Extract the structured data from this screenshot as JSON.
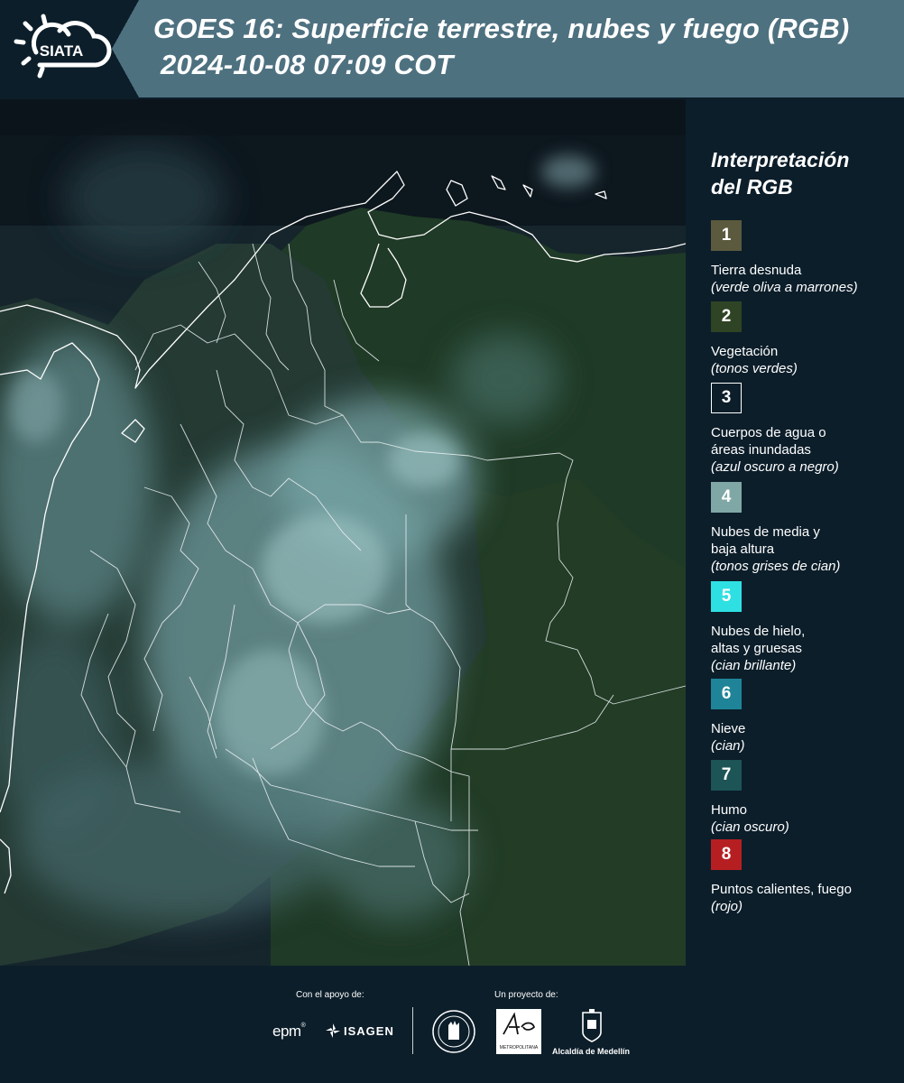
{
  "header": {
    "logo_text": "SIATA",
    "title": "GOES 16: Superficie terrestre, nubes y fuego (RGB)",
    "datetime": "2024-10-08 07:09 COT"
  },
  "legend": {
    "title_line1": "Interpretación",
    "title_line2": "del RGB",
    "items": [
      {
        "number": "1",
        "color": "#5b5a3e",
        "label": "Tierra desnuda",
        "note": "(verde oliva a marrones)"
      },
      {
        "number": "2",
        "color": "#2f4424",
        "label": "Vegetación",
        "note": "(tonos verdes)"
      },
      {
        "number": "3",
        "color": "#0c1e2a",
        "label": "Cuerpos de agua o áreas inundadas",
        "note": "(azul oscuro a negro)"
      },
      {
        "number": "4",
        "color": "#7fa7a6",
        "label": "Nubes de media y baja altura",
        "note": "(tonos grises de cian)"
      },
      {
        "number": "5",
        "color": "#2ee0e2",
        "label": "Nubes de hielo, altas y gruesas",
        "note": "(cian brillante)"
      },
      {
        "number": "6",
        "color": "#1f8498",
        "label": "Nieve",
        "note": "(cian)"
      },
      {
        "number": "7",
        "color": "#1d5456",
        "label": "Humo",
        "note": "(cian oscuro)"
      },
      {
        "number": "8",
        "color": "#b51f22",
        "label": "Puntos calientes, fuego",
        "note": "(rojo)"
      }
    ]
  },
  "footer": {
    "support_caption": "Con el apoyo de:",
    "project_caption": "Un proyecto de:",
    "sponsors": {
      "epm": "epm",
      "isagen": "ISAGEN",
      "area_metropolitana": "METROPOLITANA",
      "alcaldia": "Alcaldía de Medellín"
    }
  }
}
